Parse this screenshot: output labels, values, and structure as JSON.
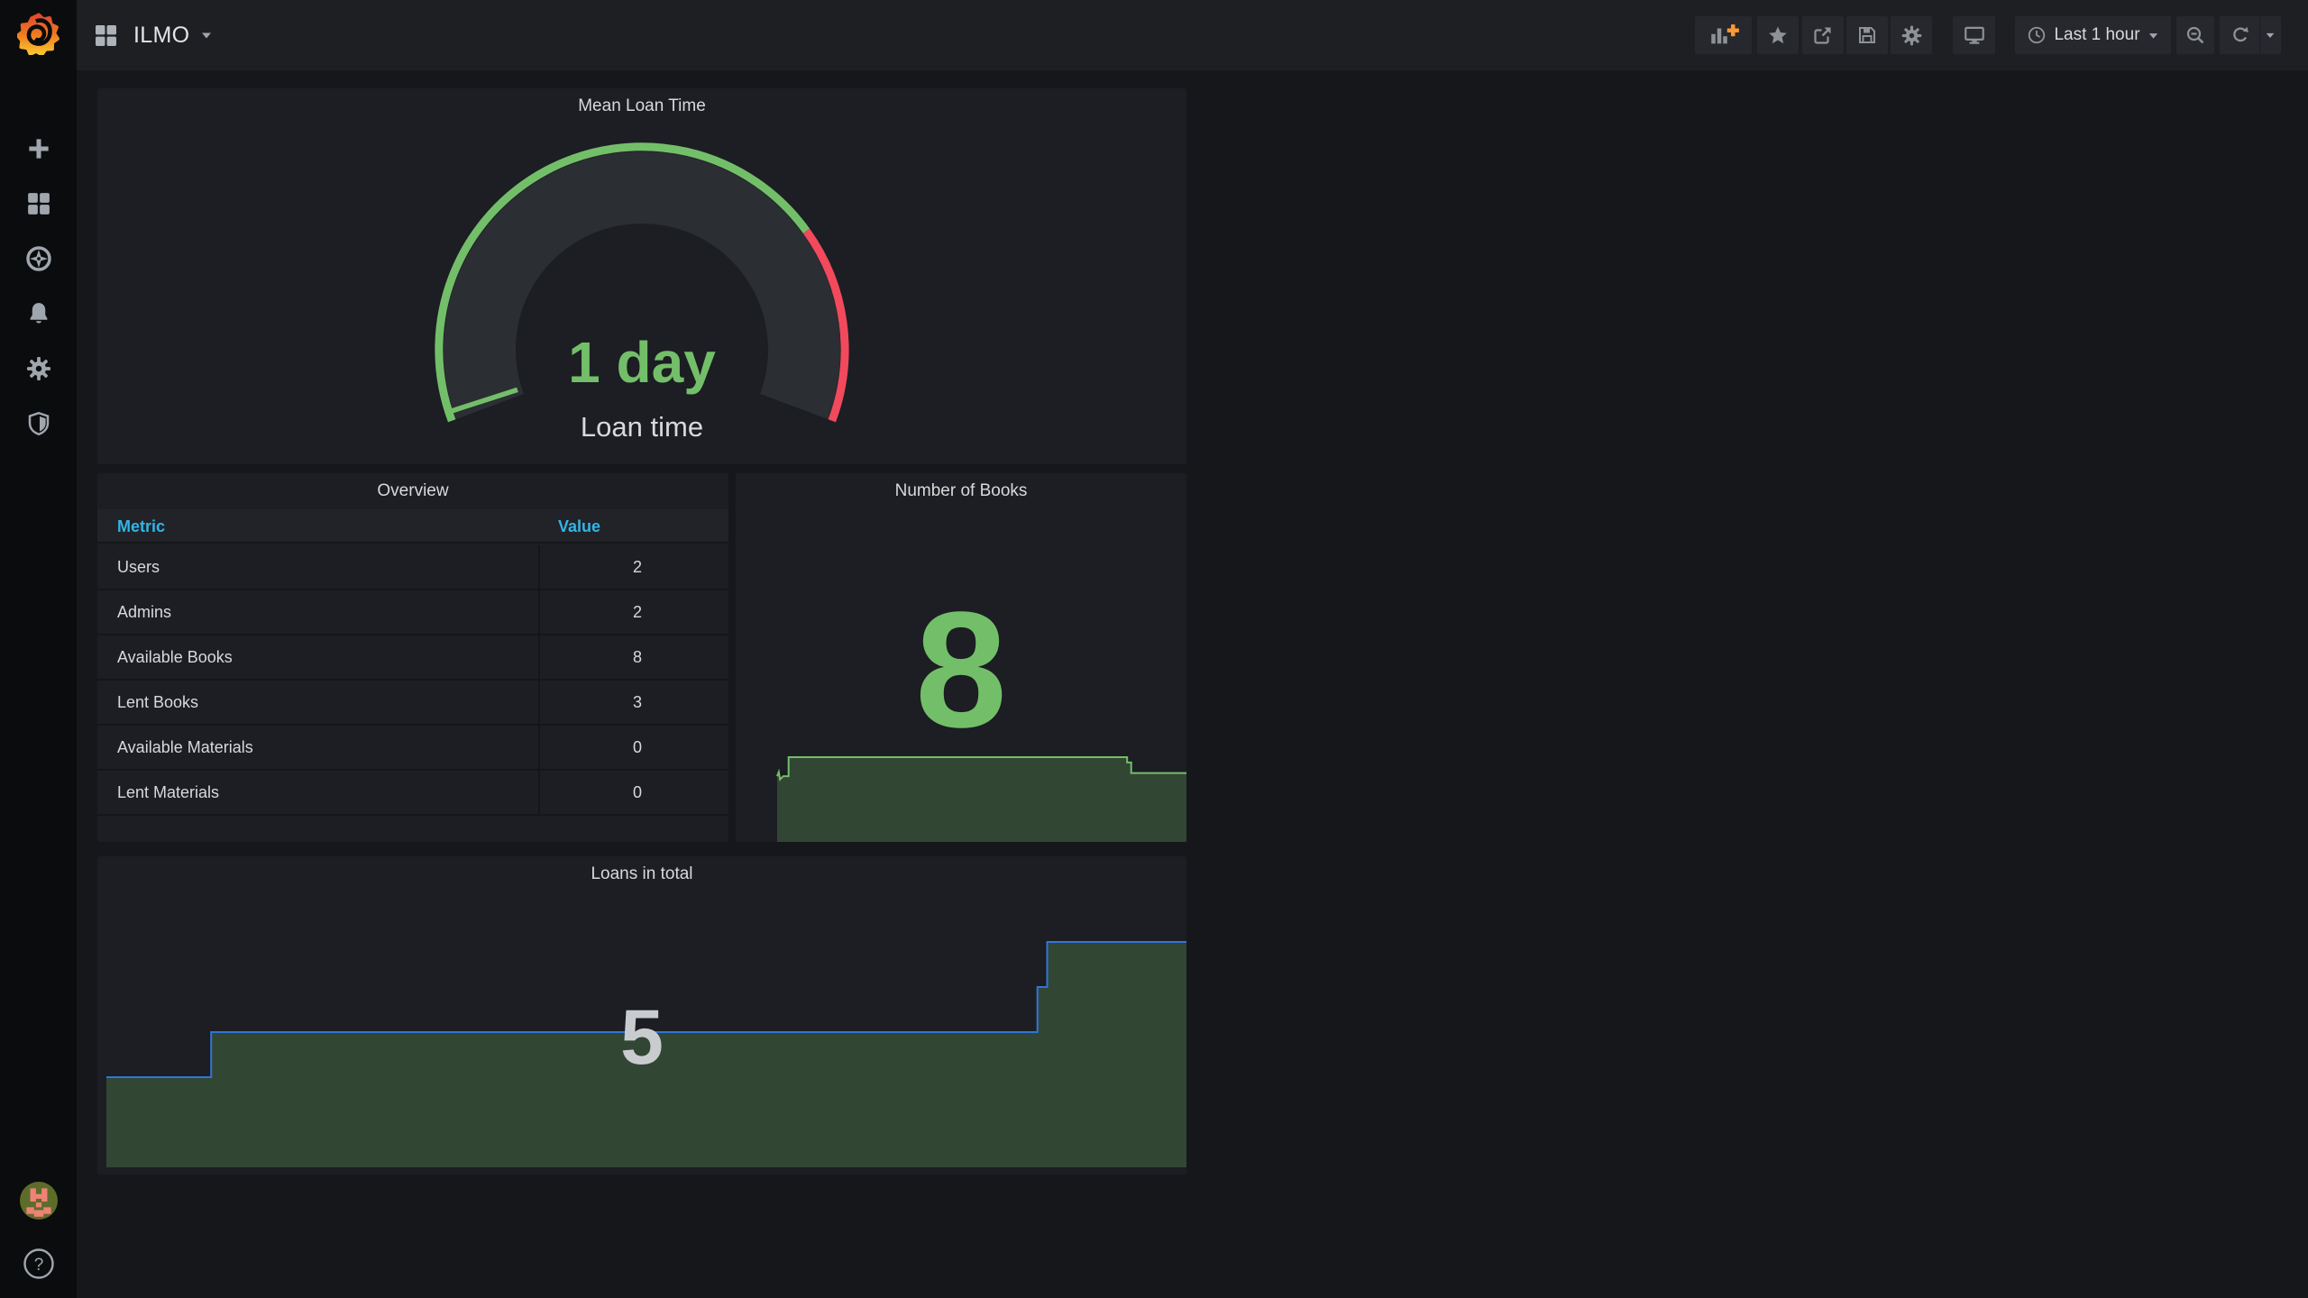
{
  "navbar": {
    "title": "ILMO",
    "time_range": "Last 1 hour"
  },
  "overview": {
    "title": "Overview",
    "columns": [
      "Metric",
      "Value"
    ],
    "rows": [
      [
        "Users",
        "2"
      ],
      [
        "Admins",
        "2"
      ],
      [
        "Available Books",
        "8"
      ],
      [
        "Lent Books",
        "3"
      ],
      [
        "Available Materials",
        "0"
      ],
      [
        "Lent Materials",
        "0"
      ]
    ]
  },
  "help_label": "?",
  "colors": {
    "green": "#73bf69",
    "red": "#f2495c",
    "blue_line": "#3274d9",
    "table_header_blue": "#33b5e5",
    "area_fill": "rgba(115,191,105,0.25)",
    "orange_plus": "#ff9830"
  },
  "chart_data": [
    {
      "id": "mean-loan-time-gauge",
      "type": "gauge",
      "title": "Mean Loan Time",
      "value_text": "1 day",
      "value": 1,
      "unit": "days",
      "label": "Loan time",
      "value_fraction": 0.012,
      "threshold_red_fraction": 0.745
    },
    {
      "id": "number-of-books",
      "type": "area",
      "title": "Number of Books",
      "current": 8,
      "ylim": [
        0,
        8
      ],
      "series": [
        [
          0,
          6.2
        ],
        [
          0.004,
          6.6
        ],
        [
          0.007,
          5.9
        ],
        [
          0.015,
          6.2
        ],
        [
          0.028,
          6.2
        ],
        [
          0.028,
          8
        ],
        [
          0.855,
          8
        ],
        [
          0.855,
          7.5
        ],
        [
          0.865,
          7.5
        ],
        [
          0.865,
          6.5
        ],
        [
          1,
          6.5
        ]
      ]
    },
    {
      "id": "loans-in-total",
      "type": "area",
      "title": "Loans in total",
      "current": 5,
      "ylim": [
        0,
        5.6
      ],
      "series": [
        [
          0,
          2
        ],
        [
          0.097,
          2
        ],
        [
          0.097,
          3
        ],
        [
          0.862,
          3
        ],
        [
          0.862,
          4
        ],
        [
          0.871,
          4
        ],
        [
          0.871,
          5
        ],
        [
          1,
          5
        ]
      ]
    }
  ]
}
